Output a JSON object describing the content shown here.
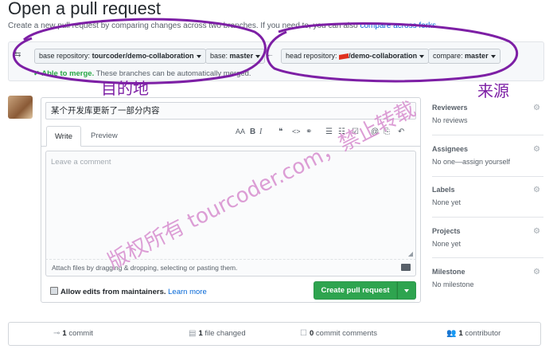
{
  "header": {
    "title": "Open a pull request",
    "subtitle": "Create a new pull request by comparing changes across two branches. If you need to, you can also",
    "subtitle_link": "compare across forks."
  },
  "compare": {
    "base_repo_label": "base repository:",
    "base_repo_value": "tourcoder/demo-collaboration",
    "base_label": "base:",
    "base_value": "master",
    "head_repo_label": "head repository:",
    "head_repo_value": "/demo-collaboration",
    "compare_label": "compare:",
    "compare_value": "master",
    "merge_ok": "✓ Able to merge.",
    "merge_text": "These branches can be automatically merged."
  },
  "form": {
    "title_value": "某个开发库更新了一部分内容",
    "tabs": [
      "Write",
      "Preview"
    ],
    "comment_placeholder": "Leave a comment",
    "attach_text": "Attach files by dragging & dropping, selecting or pasting them.",
    "allow_edits": "Allow edits from maintainers.",
    "learn_more": "Learn more",
    "create_button": "Create pull request"
  },
  "toolbar": {
    "heading": "AA",
    "bold": "B",
    "italic": "I",
    "quote": "❝",
    "code": "<>",
    "link": "⚭",
    "ul": "☰",
    "ol": "☷",
    "task": "☑",
    "mention": "@",
    "ref": "⎘",
    "reply": "↶"
  },
  "sidebar": [
    {
      "heading": "Reviewers",
      "value": "No reviews"
    },
    {
      "heading": "Assignees",
      "value": "No one—assign yourself"
    },
    {
      "heading": "Labels",
      "value": "None yet"
    },
    {
      "heading": "Projects",
      "value": "None yet"
    },
    {
      "heading": "Milestone",
      "value": "No milestone"
    }
  ],
  "stats": {
    "commits_count": "1",
    "commits_label": "commit",
    "files_count": "1",
    "files_label": "file changed",
    "comments_count": "0",
    "comments_label": "commit comments",
    "contributors_count": "1",
    "contributors_label": "contributor"
  },
  "annotations": {
    "target": "目的地",
    "source": "来源",
    "watermark_1": "版权所有 tourcoder.com，禁止转载"
  },
  "colors": {
    "primary_button": "#2ea44f",
    "link": "#0366d6",
    "annotation": "#7d1fa5",
    "watermark": "#d68cce"
  }
}
